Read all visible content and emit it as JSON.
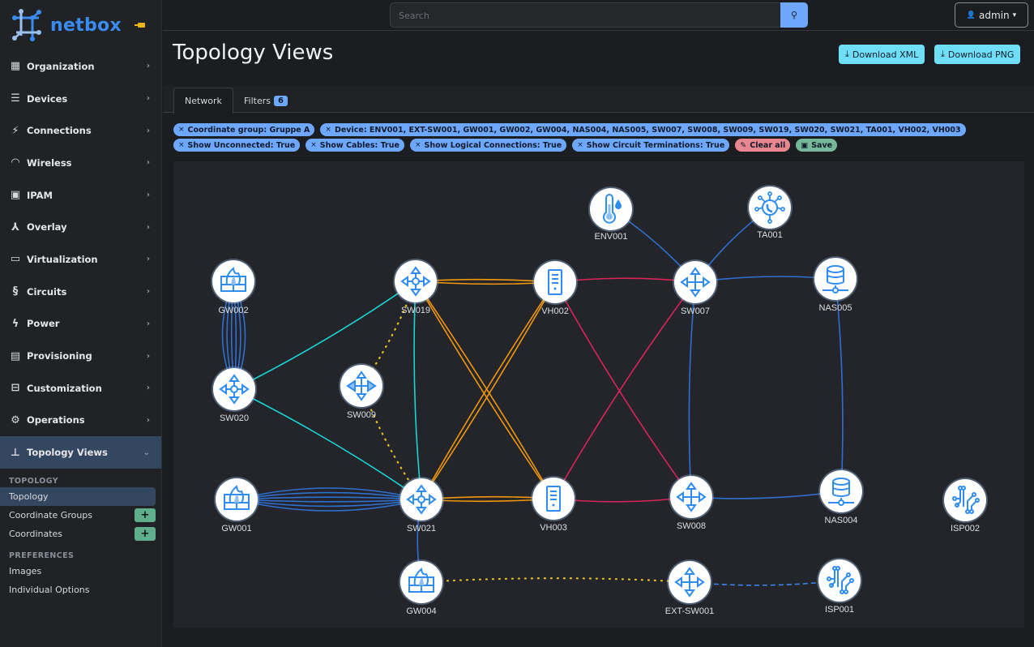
{
  "brand": {
    "name": "netbox",
    "pin_icon": "pin-icon"
  },
  "sidebar": {
    "items": [
      {
        "label": "Organization",
        "icon": "building-icon",
        "glyph": "▦"
      },
      {
        "label": "Devices",
        "icon": "server-icon",
        "glyph": "☰"
      },
      {
        "label": "Connections",
        "icon": "plug-icon",
        "glyph": "⚡"
      },
      {
        "label": "Wireless",
        "icon": "wifi-icon",
        "glyph": "◠"
      },
      {
        "label": "IPAM",
        "icon": "ip-icon",
        "glyph": "▣"
      },
      {
        "label": "Overlay",
        "icon": "graph-icon",
        "glyph": "⅄"
      },
      {
        "label": "Virtualization",
        "icon": "monitor-icon",
        "glyph": "▭"
      },
      {
        "label": "Circuits",
        "icon": "circuit-icon",
        "glyph": "§"
      },
      {
        "label": "Power",
        "icon": "power-icon",
        "glyph": "ϟ"
      },
      {
        "label": "Provisioning",
        "icon": "file-icon",
        "glyph": "▤"
      },
      {
        "label": "Customization",
        "icon": "toolbox-icon",
        "glyph": "⊟"
      },
      {
        "label": "Operations",
        "icon": "cogs-icon",
        "glyph": "⚙"
      },
      {
        "label": "Topology Views",
        "icon": "sitemap-icon",
        "glyph": "⊥",
        "active": true
      }
    ],
    "submenu": {
      "section_topology": "TOPOLOGY",
      "topology": "Topology",
      "coordinate_groups": "Coordinate Groups",
      "coordinates": "Coordinates",
      "section_preferences": "PREFERENCES",
      "images": "Images",
      "individual_options": "Individual Options",
      "add_symbol": "+"
    },
    "chevron_right": "›",
    "chevron_down": "⌄"
  },
  "topbar": {
    "search_placeholder": "Search",
    "search_icon": "⚲",
    "user_label": "admin",
    "user_icon": "👤",
    "caret": "▾"
  },
  "page": {
    "title": "Topology Views",
    "download_xml": "Download XML",
    "download_png": "Download PNG",
    "download_icon": "⤓"
  },
  "tabs": {
    "network": "Network",
    "filters": "Filters",
    "filters_count": "6"
  },
  "filters": {
    "remove_symbol": "×",
    "row1": [
      "Coordinate group: Gruppe A",
      "Device: ENV001, EXT-SW001, GW001, GW002, GW004, NAS004, NAS005, SW007, SW008, SW009, SW019, SW020, SW021, TA001, VH002, VH003"
    ],
    "row2": [
      "Show Unconnected: True",
      "Show Cables: True",
      "Show Logical Connections: True",
      "Show Circuit Terminations: True"
    ],
    "clear_all": "Clear all",
    "save": "Save"
  },
  "topology": {
    "colors": {
      "cable_blue": "#2f6fd0",
      "cable_cyan": "#18d6d6",
      "cable_orange": "#f0960a",
      "cable_crimson": "#d8245a",
      "logical_yellow": "#e8c020",
      "circuit_blue": "#3a86e8",
      "icon_blue": "#2f8cf0"
    },
    "nodes": [
      {
        "id": "ENV001",
        "type": "sensor"
      },
      {
        "id": "TA001",
        "type": "phone"
      },
      {
        "id": "GW002",
        "type": "firewall"
      },
      {
        "id": "SW019",
        "type": "switch-core"
      },
      {
        "id": "VH002",
        "type": "server"
      },
      {
        "id": "SW007",
        "type": "switch"
      },
      {
        "id": "NAS005",
        "type": "storage"
      },
      {
        "id": "SW020",
        "type": "switch-core"
      },
      {
        "id": "SW009",
        "type": "switch-l2"
      },
      {
        "id": "GW001",
        "type": "firewall"
      },
      {
        "id": "SW021",
        "type": "switch-core"
      },
      {
        "id": "VH003",
        "type": "server"
      },
      {
        "id": "SW008",
        "type": "switch"
      },
      {
        "id": "NAS004",
        "type": "storage"
      },
      {
        "id": "ISP002",
        "type": "circuit"
      },
      {
        "id": "GW004",
        "type": "firewall"
      },
      {
        "id": "EXT-SW001",
        "type": "switch"
      },
      {
        "id": "ISP001",
        "type": "circuit"
      }
    ],
    "links": [
      {
        "a": "GW002",
        "b": "SW020",
        "color": "cable_blue",
        "count": 6
      },
      {
        "a": "SW020",
        "b": "SW019",
        "color": "cable_cyan",
        "count": 1
      },
      {
        "a": "SW020",
        "b": "SW021",
        "color": "cable_cyan",
        "count": 1
      },
      {
        "a": "SW019",
        "b": "SW021",
        "color": "cable_cyan",
        "count": 1
      },
      {
        "a": "SW019",
        "b": "VH002",
        "color": "cable_orange",
        "count": 2
      },
      {
        "a": "SW019",
        "b": "VH003",
        "color": "cable_orange",
        "count": 2
      },
      {
        "a": "SW021",
        "b": "VH002",
        "color": "cable_orange",
        "count": 2
      },
      {
        "a": "SW021",
        "b": "VH003",
        "color": "cable_orange",
        "count": 2
      },
      {
        "a": "VH002",
        "b": "SW007",
        "color": "cable_crimson",
        "count": 1
      },
      {
        "a": "VH002",
        "b": "SW008",
        "color": "cable_crimson",
        "count": 1
      },
      {
        "a": "VH003",
        "b": "SW007",
        "color": "cable_crimson",
        "count": 1
      },
      {
        "a": "VH003",
        "b": "SW008",
        "color": "cable_crimson",
        "count": 1
      },
      {
        "a": "ENV001",
        "b": "SW007",
        "color": "cable_blue",
        "count": 1
      },
      {
        "a": "TA001",
        "b": "SW007",
        "color": "cable_blue",
        "count": 1
      },
      {
        "a": "SW007",
        "b": "NAS005",
        "color": "cable_blue",
        "count": 1
      },
      {
        "a": "SW007",
        "b": "SW008",
        "color": "cable_blue",
        "count": 1
      },
      {
        "a": "NAS005",
        "b": "NAS004",
        "color": "cable_blue",
        "count": 1
      },
      {
        "a": "SW008",
        "b": "NAS004",
        "color": "cable_blue",
        "count": 1
      },
      {
        "a": "GW001",
        "b": "SW021",
        "color": "cable_blue",
        "count": 6
      },
      {
        "a": "SW021",
        "b": "GW004",
        "color": "cable_blue",
        "count": 1
      },
      {
        "a": "SW019",
        "b": "SW009",
        "color": "logical_yellow",
        "count": 1,
        "style": "dotted"
      },
      {
        "a": "SW009",
        "b": "SW021",
        "color": "logical_yellow",
        "count": 1,
        "style": "dotted"
      },
      {
        "a": "GW004",
        "b": "EXT-SW001",
        "color": "logical_yellow",
        "count": 1,
        "style": "dotted"
      },
      {
        "a": "EXT-SW001",
        "b": "ISP001",
        "color": "circuit_blue",
        "count": 1,
        "style": "dashed"
      }
    ]
  }
}
